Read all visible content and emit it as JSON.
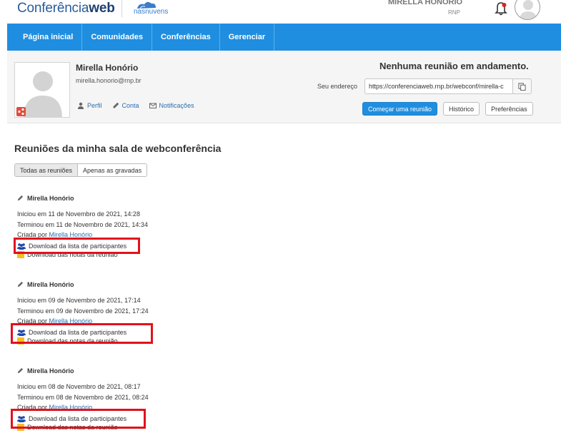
{
  "header": {
    "logo_light": "Conferência",
    "logo_bold": "web",
    "partner": "nasnuvens",
    "user_name": "MIRELLA HONÓRIO",
    "user_org": "RNP"
  },
  "nav": {
    "items": [
      "Página inicial",
      "Comunidades",
      "Conferências",
      "Gerenciar"
    ]
  },
  "profile": {
    "name": "Mirella Honório",
    "email": "mirella.honorio@rnp.br",
    "links": {
      "perfil": "Perfil",
      "conta": "Conta",
      "notificacoes": "Notificações"
    }
  },
  "room": {
    "status": "Nenhuma reunião em andamento.",
    "address_label": "Seu endereço",
    "address_value": "https://conferenciaweb.rnp.br/webconf/mirella-c",
    "start_button": "Começar uma reunião",
    "history_button": "Histórico",
    "prefs_button": "Preferências"
  },
  "main": {
    "section_title": "Reuniões da minha sala de webconferência",
    "filters": [
      "Todas as reuniões",
      "Apenas as gravadas"
    ]
  },
  "meetings": [
    {
      "title": "Mirella Honório",
      "started": "Iniciou em 11 de Novembro de 2021, 14:28",
      "ended": "Terminou em 11 de Novembro de 2021, 14:34",
      "created_prefix": "Criada por",
      "creator": "Mirella Honório",
      "download_participants": "Download da lista de participantes",
      "download_notes": "Download das notas da reunião"
    },
    {
      "title": "Mirella Honório",
      "started": "Iniciou em 09 de Novembro de 2021, 17:14",
      "ended": "Terminou em 09 de Novembro de 2021, 17:24",
      "created_prefix": "Criada por",
      "creator": "Mirella Honório",
      "download_participants": "Download da lista de participantes",
      "download_notes": "Download das notas da reunião"
    },
    {
      "title": "Mirella Honório",
      "started": "Iniciou em 08 de Novembro de 2021, 08:17",
      "ended": "Terminou em 08 de Novembro de 2021, 08:24",
      "created_prefix": "Criada por",
      "creator": "Mirella Honório",
      "download_participants": "Download da lista de participantes",
      "download_notes": "Download das notas da reunião"
    }
  ],
  "colors": {
    "nav_blue": "#1f8ee0",
    "link_blue": "#2a6db0",
    "highlight_red": "#e0121c",
    "notes_yellow": "#f5bf1f"
  }
}
